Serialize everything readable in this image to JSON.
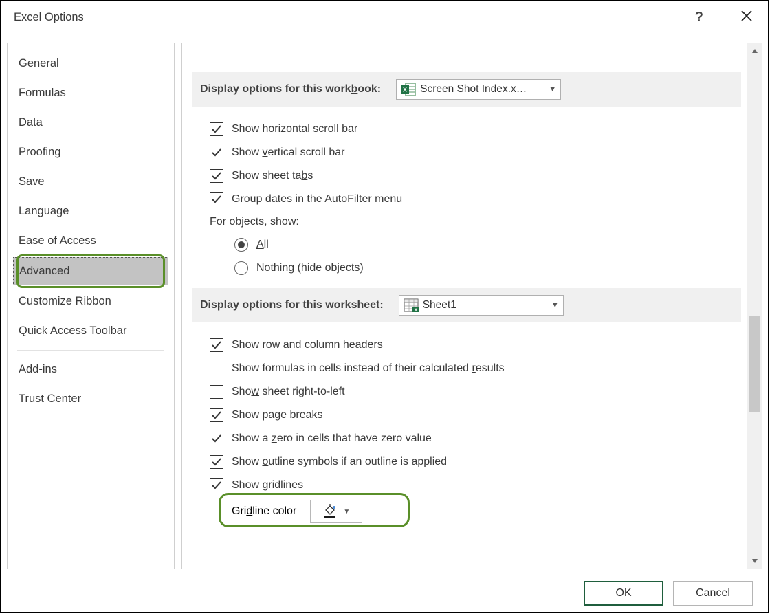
{
  "titlebar": {
    "title": "Excel Options"
  },
  "sidebar": {
    "items": [
      {
        "label": "General"
      },
      {
        "label": "Formulas"
      },
      {
        "label": "Data"
      },
      {
        "label": "Proofing"
      },
      {
        "label": "Save"
      },
      {
        "label": "Language"
      },
      {
        "label": "Ease of Access"
      },
      {
        "label": "Advanced",
        "selected": true
      },
      {
        "label": "Customize Ribbon"
      },
      {
        "label": "Quick Access Toolbar"
      },
      {
        "label": "Add-ins"
      },
      {
        "label": "Trust Center"
      }
    ]
  },
  "workbook_section": {
    "title_pre": "Display options for this work",
    "title_u": "b",
    "title_post": "ook:",
    "combo_value": "Screen Shot Index.x…",
    "opts": {
      "hscroll_pre": "Show horizon",
      "hscroll_u": "t",
      "hscroll_post": "al scroll bar",
      "vscroll_pre": "Show ",
      "vscroll_u": "v",
      "vscroll_post": "ertical scroll bar",
      "tabs_pre": "Show sheet ta",
      "tabs_u": "b",
      "tabs_post": "s",
      "group_pre": "",
      "group_u": "G",
      "group_post": "roup dates in the AutoFilter menu",
      "objects_label": "For objects, show:",
      "radio_all_u": "A",
      "radio_all_post": "ll",
      "radio_none_pre": "Nothing (hi",
      "radio_none_u": "d",
      "radio_none_post": "e objects)"
    }
  },
  "worksheet_section": {
    "title_pre": "Display options for this work",
    "title_u": "s",
    "title_post": "heet:",
    "combo_value": "Sheet1",
    "opts": {
      "headers_pre": "Show row and column ",
      "headers_u": "h",
      "headers_post": "eaders",
      "formulas_pre": "Show formulas in cells instead of their calculated ",
      "formulas_u": "r",
      "formulas_post": "esults",
      "rtl_pre": "Sho",
      "rtl_u": "w",
      "rtl_post": " sheet right-to-left",
      "pbreaks_pre": "Show page brea",
      "pbreaks_u": "k",
      "pbreaks_post": "s",
      "zero_pre": "Show a ",
      "zero_u": "z",
      "zero_post": "ero in cells that have zero value",
      "outline_pre": "Show ",
      "outline_u": "o",
      "outline_post": "utline symbols if an outline is applied",
      "gridlines_pre": "Show g",
      "gridlines_u": "r",
      "gridlines_post": "idlines",
      "gridcolor_pre": "Gri",
      "gridcolor_u": "d",
      "gridcolor_post": "line color"
    }
  },
  "footer": {
    "ok": "OK",
    "cancel": "Cancel"
  }
}
